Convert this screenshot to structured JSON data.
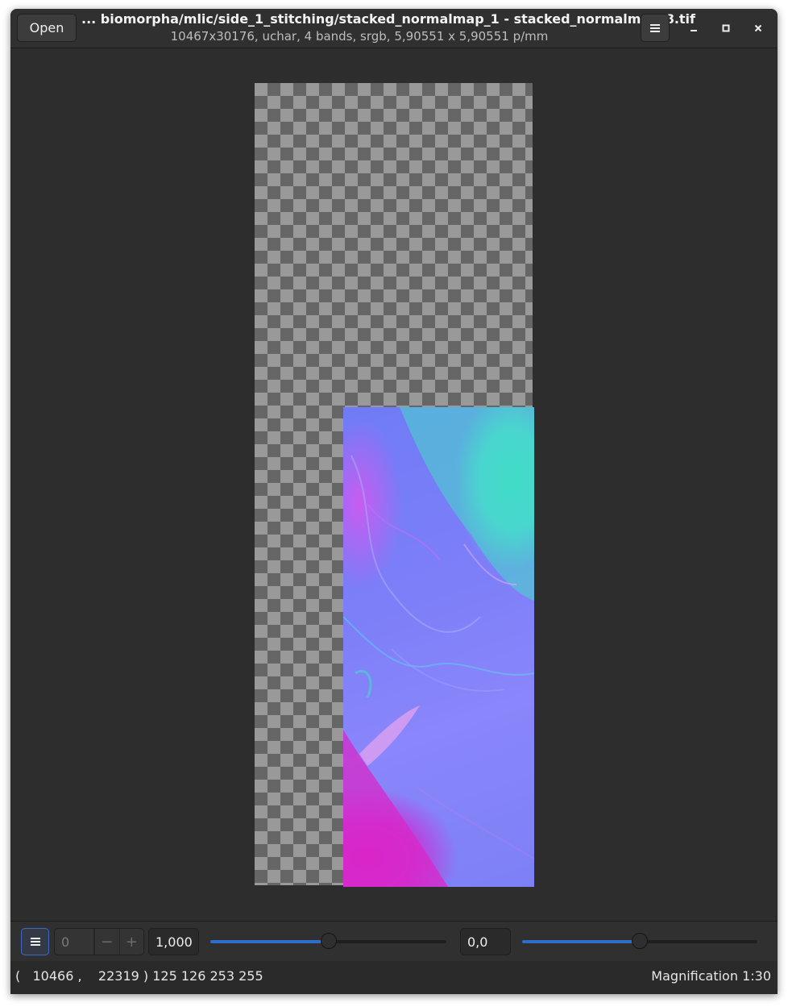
{
  "header": {
    "open_label": "Open",
    "title": "... biomorpha/mlic/side_1_stitching/stacked_normalmap_1 - stacked_normalmap_8.tif",
    "subtitle": "10467x30176,  uchar, 4 bands, srgb, 5,90551 x 5,90551 p/mm",
    "menu_icon": "hamburger-menu-icon",
    "window_controls": [
      "minimize-icon",
      "maximize-icon",
      "close-icon"
    ]
  },
  "toolbar": {
    "menu_icon": "hamburger-menu-icon",
    "page_value": "0",
    "decrement_label": "−",
    "increment_label": "+",
    "scale_value": "1,000",
    "scale_slider_fraction": 0.5,
    "offset_value": "0,0",
    "offset_slider_fraction": 0.5
  },
  "status": {
    "coords": "(   10466 ,    22319 ) 125 126 253 255",
    "magnification": "Magnification 1:30"
  },
  "colors": {
    "window_bg": "#2d2d2d",
    "accent": "#2f6ec8"
  }
}
